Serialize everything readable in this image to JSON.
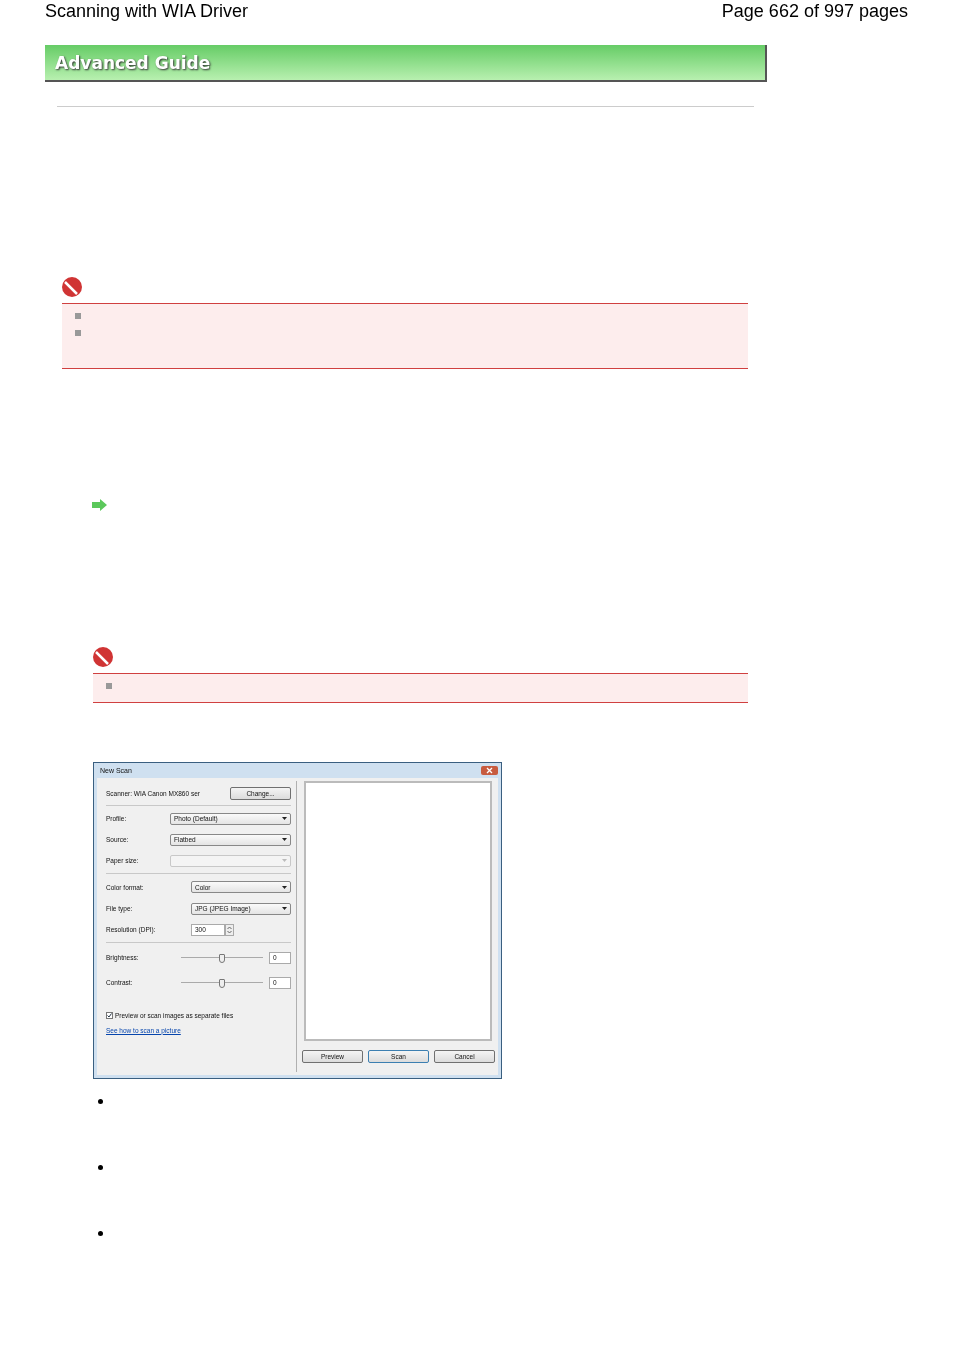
{
  "header": {
    "title": "Scanning with WIA Driver",
    "pages": "Page 662 of 997 pages"
  },
  "banner": {
    "title": "Advanced Guide"
  },
  "dialog": {
    "title": "New Scan",
    "scanner": "Scanner: WIA Canon MX860 ser",
    "change_button": "Change...",
    "dropdowns": [
      {
        "label": "Profile:",
        "value": "Photo (Default)",
        "disabled": false
      },
      {
        "label": "Source:",
        "value": "Flatbed",
        "disabled": false
      },
      {
        "label": "Paper size:",
        "disabled": true
      },
      {
        "label": "Color format:",
        "value": "Color",
        "disabled": false
      },
      {
        "label": "File type:",
        "value": "JPG (JPEG Image)",
        "disabled": false
      }
    ],
    "resolution": {
      "label": "Resolution (DPI):",
      "value": "300"
    },
    "sliders": [
      {
        "label": "Brightness:",
        "level": 0.5,
        "value": "0"
      },
      {
        "label": "Contrast:",
        "level": 0.5,
        "value": "0"
      }
    ],
    "checkbox": {
      "label": "Preview or scan images as separate files",
      "checked": true
    },
    "link": "See how to scan a picture",
    "buttons": [
      {
        "label": "Preview",
        "selected": false
      },
      {
        "label": "Scan",
        "selected": true
      },
      {
        "label": "Cancel",
        "selected": false
      }
    ]
  }
}
